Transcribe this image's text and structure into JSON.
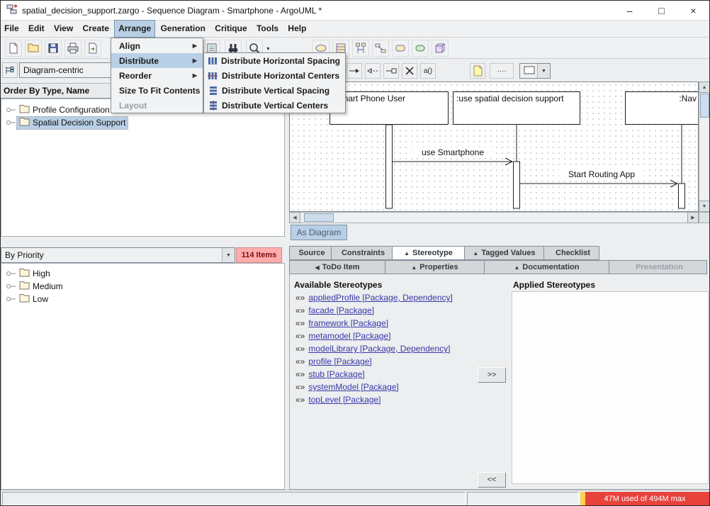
{
  "window": {
    "title": "spatial_decision_support.zargo - Sequence Diagram - Smartphone - ArgoUML *",
    "minimize": "–",
    "maximize": "□",
    "close": "×"
  },
  "menubar": {
    "items": [
      {
        "label": "File"
      },
      {
        "label": "Edit"
      },
      {
        "label": "View"
      },
      {
        "label": "Create"
      },
      {
        "label": "Arrange"
      },
      {
        "label": "Generation"
      },
      {
        "label": "Critique"
      },
      {
        "label": "Tools"
      },
      {
        "label": "Help"
      }
    ]
  },
  "arrange_menu": {
    "items": [
      {
        "label": "Align",
        "has_submenu": true
      },
      {
        "label": "Distribute",
        "has_submenu": true,
        "highlighted": true
      },
      {
        "label": "Reorder",
        "has_submenu": true
      },
      {
        "label": "Size To Fit Contents",
        "has_submenu": false
      },
      {
        "label": "Layout",
        "has_submenu": false,
        "disabled": true
      }
    ]
  },
  "distribute_menu": {
    "items": [
      {
        "label": "Distribute Horizontal Spacing"
      },
      {
        "label": "Distribute Horizontal Centers"
      },
      {
        "label": "Distribute Vertical Spacing"
      },
      {
        "label": "Distribute Vertical Centers"
      }
    ]
  },
  "explorer": {
    "perspective_value": "Diagram-centric",
    "order_label": "Order By Type, Name",
    "tree": [
      {
        "label": "Profile Configuration"
      },
      {
        "label": "Spatial Decision Support",
        "selected": true
      }
    ]
  },
  "todo_pane": {
    "filter_value": "By Priority",
    "count_badge": "114 Items",
    "tree": [
      {
        "label": "High"
      },
      {
        "label": "Medium"
      },
      {
        "label": "Low"
      }
    ]
  },
  "diagram": {
    "tab_label": "As Diagram",
    "lifelines": [
      {
        "name": ":Smart Phone User"
      },
      {
        "name": ":use spatial decision support"
      },
      {
        "name": ":Nav"
      }
    ],
    "messages": [
      {
        "label": "use Smartphone"
      },
      {
        "label": "Start Routing App"
      }
    ]
  },
  "details": {
    "tabs_row1": [
      {
        "arrow": "",
        "label": "Source"
      },
      {
        "arrow": "",
        "label": "Constraints"
      },
      {
        "arrow": "▲",
        "label": "Stereotype",
        "selected": true
      },
      {
        "arrow": "▲",
        "label": "Tagged Values"
      },
      {
        "arrow": "",
        "label": "Checklist"
      }
    ],
    "tabs_row2": [
      {
        "arrow": "◀",
        "label": "ToDo Item"
      },
      {
        "arrow": "▲",
        "label": "Properties"
      },
      {
        "arrow": "▲",
        "label": "Documentation"
      },
      {
        "arrow": "",
        "label": "Presentation",
        "disabled": true
      }
    ],
    "stereotype": {
      "available_label": "Available Stereotypes",
      "applied_label": "Applied Stereotypes",
      "available": [
        "appliedProfile [Package, Dependency]",
        "facade [Package]",
        "framework [Package]",
        "metamodel [Package]",
        "modelLibrary [Package, Dependency]",
        "profile [Package]",
        "stub [Package]",
        "systemModel [Package]",
        "topLevel [Package]"
      ],
      "add_label": ">>",
      "remove_label": "<<"
    }
  },
  "statusbar": {
    "memory": "47M used of 494M max"
  },
  "icons": {
    "submenu_arrow": "▶",
    "caret_down": "▼",
    "scroll_up": "▲",
    "scroll_down": "▼",
    "scroll_left": "◀",
    "scroll_right": "▶",
    "guillemets": "«»",
    "action_tool": "a()",
    "spline_tool": "····"
  },
  "colors": {
    "selection": "#b8cfe5",
    "badge_bg": "#ffacac",
    "badge_text": "#7a1010",
    "memory_bg": "#e8423d",
    "memory_used": "#ffd24d",
    "link": "#3737a8"
  }
}
